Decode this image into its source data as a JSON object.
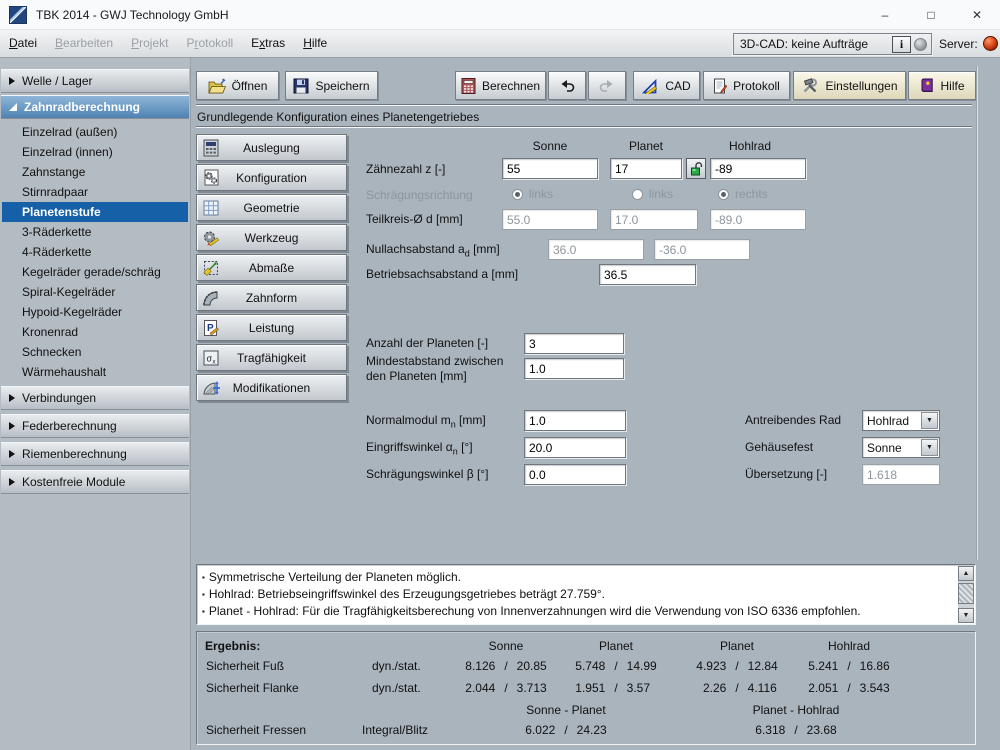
{
  "window": {
    "title": "TBK 2014 - GWJ Technology GmbH",
    "controls": {
      "minimize": "–",
      "maximize": "□",
      "close": "✕"
    }
  },
  "menubar": {
    "items": [
      {
        "pre": "",
        "key": "D",
        "post": "atei"
      },
      {
        "pre": "",
        "key": "B",
        "post": "earbeiten"
      },
      {
        "pre": "",
        "key": "P",
        "post": "rojekt"
      },
      {
        "pre": "P",
        "key": "r",
        "post": "otokoll"
      },
      {
        "pre": "E",
        "key": "x",
        "post": "tras"
      },
      {
        "pre": "",
        "key": "H",
        "post": "ilfe"
      }
    ],
    "cad_status": "3D-CAD: keine Aufträge",
    "info_glyph": "i",
    "server_label": "Server:"
  },
  "sidebar": {
    "sections": [
      {
        "label": "Welle / Lager"
      },
      {
        "label": "Zahnradberechnung"
      },
      {
        "label": "Verbindungen"
      },
      {
        "label": "Federberechnung"
      },
      {
        "label": "Riemenberechnung"
      },
      {
        "label": "Kostenfreie Module"
      }
    ],
    "gear_items": [
      {
        "label": "Einzelrad (außen)"
      },
      {
        "label": "Einzelrad (innen)"
      },
      {
        "label": "Zahnstange"
      },
      {
        "label": "Stirnradpaar"
      },
      {
        "label": "Planetenstufe"
      },
      {
        "label": "3-Räderkette"
      },
      {
        "label": "4-Räderkette"
      },
      {
        "label": "Kegelräder gerade/schräg"
      },
      {
        "label": "Spiral-Kegelräder"
      },
      {
        "label": "Hypoid-Kegelräder"
      },
      {
        "label": "Kronenrad"
      },
      {
        "label": "Schnecken"
      },
      {
        "label": "Wärmehaushalt"
      }
    ]
  },
  "toolbar": {
    "open": "Öffnen",
    "save": "Speichern",
    "calc": "Berechnen",
    "cad": "CAD",
    "protocol": "Protokoll",
    "settings": "Einstellungen",
    "help": "Hilfe"
  },
  "page": {
    "subtitle": "Grundlegende Konfiguration eines Planetengetriebes"
  },
  "nav": {
    "buttons": [
      "Auslegung",
      "Konfiguration",
      "Geometrie",
      "Werkzeug",
      "Abmaße",
      "Zahnform",
      "Leistung",
      "Tragfähigkeit",
      "Modifikationen"
    ]
  },
  "form": {
    "columns": [
      "Sonne",
      "Planet",
      "Hohlrad"
    ],
    "teeth": {
      "label": "Zähnezahl z [-]",
      "sonne": "55",
      "planet": "17",
      "hohlrad": "-89"
    },
    "helix_dir": {
      "label": "Schrägungsrichtung",
      "options": [
        "links",
        "links",
        "rechts"
      ]
    },
    "pitch": {
      "label": "Teilkreis-Ø d [mm]",
      "sonne": "55.0",
      "planet": "17.0",
      "hohlrad": "-89.0"
    },
    "null_dist": {
      "label_pre": "Nullachsabstand a",
      "label_sub": "d",
      "label_post": " [mm]",
      "v1": "36.0",
      "v2": "-36.0"
    },
    "op_dist": {
      "label": "Betriebsachsabstand a [mm]",
      "value": "36.5"
    },
    "planet_count": {
      "label": "Anzahl der Planeten [-]",
      "value": "3"
    },
    "min_dist": {
      "label": "Mindestabstand zwischen den Planeten [mm]",
      "value": "1.0"
    },
    "module": {
      "label_pre": "Normalmodul m",
      "label_sub": "n",
      "label_post": " [mm]",
      "value": "1.0"
    },
    "pressure_angle": {
      "label_pre": "Eingriffswinkel α",
      "label_sub": "n",
      "label_post": " [°]",
      "value": "20.0"
    },
    "helix_angle": {
      "label": "Schrägungswinkel β [°]",
      "value": "0.0"
    },
    "driving": {
      "label": "Antreibendes Rad",
      "value": "Hohlrad"
    },
    "fixed": {
      "label": "Gehäusefest",
      "value": "Sonne"
    },
    "ratio": {
      "label": "Übersetzung [-]",
      "value": "1.618"
    }
  },
  "messages": {
    "bullet": "▪",
    "lines": [
      "Symmetrische Verteilung der Planeten möglich.",
      "Hohlrad: Betriebseingriffswinkel des Erzeugungsgetriebes beträgt 27.759°.",
      "Planet - Hohlrad: Für die Tragfähigkeitsberechung von Innenverzahnungen wird die Verwendung von ISO 6336 empfohlen."
    ]
  },
  "results": {
    "title": "Ergebnis:",
    "sep": "/",
    "columns": [
      "Sonne",
      "Planet",
      "Planet",
      "Hohlrad"
    ],
    "rows": [
      {
        "label": "Sicherheit Fuß",
        "method": "dyn./stat.",
        "values": [
          {
            "a": "8.126",
            "b": "20.85"
          },
          {
            "a": "5.748",
            "b": "14.99"
          },
          {
            "a": "4.923",
            "b": "12.84"
          },
          {
            "a": "5.241",
            "b": "16.86"
          }
        ]
      },
      {
        "label": "Sicherheit Flanke",
        "method": "dyn./stat.",
        "values": [
          {
            "a": "2.044",
            "b": "3.713"
          },
          {
            "a": "1.951",
            "b": "3.57"
          },
          {
            "a": "2.26",
            "b": "4.116"
          },
          {
            "a": "2.051",
            "b": "3.543"
          }
        ]
      }
    ],
    "pair_columns": [
      "Sonne - Planet",
      "Planet - Hohlrad"
    ],
    "fressen": {
      "label": "Sicherheit Fressen",
      "method": "Integral/Blitz",
      "values": [
        {
          "a": "6.022",
          "b": "24.23"
        },
        {
          "a": "6.318",
          "b": "23.68"
        }
      ]
    }
  },
  "icons": {
    "dropdown_arrow": "▼",
    "scroll_up": "▲",
    "scroll_down": "▼",
    "sigma": "σx",
    "leistung_p": "P"
  },
  "colors": {
    "selection_blue": "#1660a8",
    "section_header_top": "#8fb6d8",
    "section_header_bottom": "#4e82b2",
    "server_dot_red": "#cf3c12",
    "button_beige": "#eee7cc",
    "lock_green": "#2aa84a",
    "background": "#aab4bd"
  }
}
